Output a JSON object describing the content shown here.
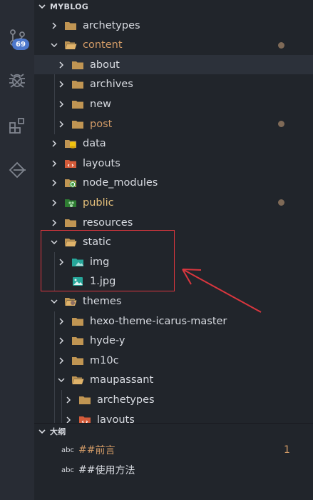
{
  "activity_bar": {
    "scm_badge": "69",
    "items": [
      {
        "icon": "source-control-icon"
      },
      {
        "icon": "debug-bug-icon"
      },
      {
        "icon": "extensions-icon"
      },
      {
        "icon": "remote-explorer-icon"
      }
    ]
  },
  "explorer": {
    "title": "MYBLOG",
    "tree": [
      {
        "label": "archetypes",
        "type": "folder",
        "expanded": false
      },
      {
        "label": "content",
        "type": "folder-open",
        "expanded": true,
        "modified": true
      },
      {
        "label": "about",
        "type": "folder",
        "expanded": false
      },
      {
        "label": "archives",
        "type": "folder",
        "expanded": false
      },
      {
        "label": "new",
        "type": "folder",
        "expanded": false
      },
      {
        "label": "post",
        "type": "folder",
        "expanded": false,
        "modified": true
      },
      {
        "label": "data",
        "type": "folder-data",
        "expanded": false
      },
      {
        "label": "layouts",
        "type": "folder-layouts",
        "expanded": false
      },
      {
        "label": "node_modules",
        "type": "folder-node",
        "expanded": false
      },
      {
        "label": "public",
        "type": "folder-public",
        "expanded": false,
        "modified": true
      },
      {
        "label": "resources",
        "type": "folder",
        "expanded": false
      },
      {
        "label": "static",
        "type": "folder-open",
        "expanded": true
      },
      {
        "label": "img",
        "type": "folder-images",
        "expanded": false
      },
      {
        "label": "1.jpg",
        "type": "image-file"
      },
      {
        "label": "themes",
        "type": "folder-themes",
        "expanded": true
      },
      {
        "label": "hexo-theme-icarus-master",
        "type": "folder",
        "expanded": false
      },
      {
        "label": "hyde-y",
        "type": "folder",
        "expanded": false
      },
      {
        "label": "m10c",
        "type": "folder",
        "expanded": false
      },
      {
        "label": "maupassant",
        "type": "folder-open",
        "expanded": true
      },
      {
        "label": "archetypes",
        "type": "folder",
        "expanded": false
      },
      {
        "label": "layouts",
        "type": "folder-layouts",
        "expanded": false
      }
    ]
  },
  "outline": {
    "title": "大纲",
    "items": [
      {
        "kind": "abc",
        "prefix": "##",
        "text": "前言",
        "count": "1"
      },
      {
        "kind": "abc",
        "prefix": "##",
        "text": "使用方法",
        "count": ""
      }
    ]
  },
  "colors": {
    "background": "#21252b",
    "activity_bar": "#282c34",
    "folder": "#c09553",
    "modified_text": "#d19a66",
    "annotation_red": "#d9363e",
    "badge": "#4d78cc"
  }
}
